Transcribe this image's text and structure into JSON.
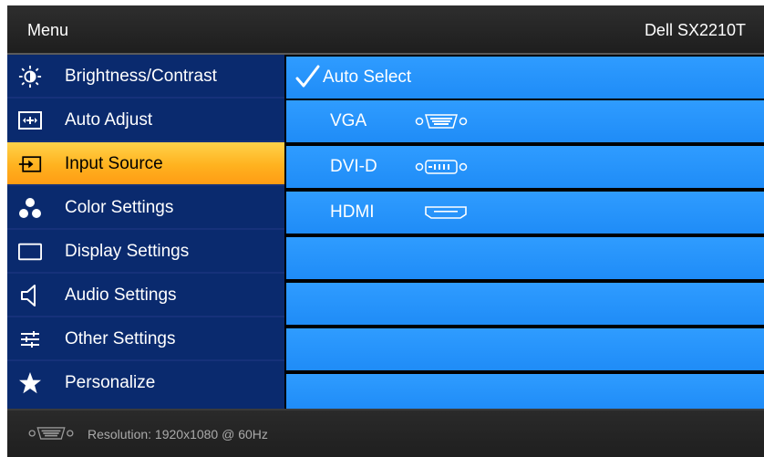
{
  "header": {
    "title": "Menu",
    "model": "Dell SX2210T"
  },
  "sidebar": {
    "items": [
      {
        "label": "Brightness/Contrast",
        "icon": "brightness-icon"
      },
      {
        "label": "Auto Adjust",
        "icon": "auto-adjust-icon"
      },
      {
        "label": "Input Source",
        "icon": "input-source-icon",
        "selected": true
      },
      {
        "label": "Color Settings",
        "icon": "color-settings-icon"
      },
      {
        "label": "Display Settings",
        "icon": "display-settings-icon"
      },
      {
        "label": "Audio Settings",
        "icon": "speaker-icon"
      },
      {
        "label": "Other Settings",
        "icon": "sliders-icon"
      },
      {
        "label": "Personalize",
        "icon": "star-icon"
      }
    ]
  },
  "content": {
    "options": [
      {
        "label": "Auto Select",
        "checked": true,
        "icon": "check-icon"
      },
      {
        "label": "VGA",
        "icon": "vga-port-icon"
      },
      {
        "label": "DVI-D",
        "icon": "dvi-port-icon"
      },
      {
        "label": "HDMI",
        "icon": "hdmi-port-icon"
      }
    ]
  },
  "footer": {
    "resolution_text": "Resolution: 1920x1080 @ 60Hz",
    "icon": "vga-port-icon"
  },
  "colors": {
    "sidebar_bg": "#0a2a6e",
    "selected_bg": "#ffb21f",
    "content_row_bg": "#2f9cff",
    "header_bg": "#262626"
  }
}
